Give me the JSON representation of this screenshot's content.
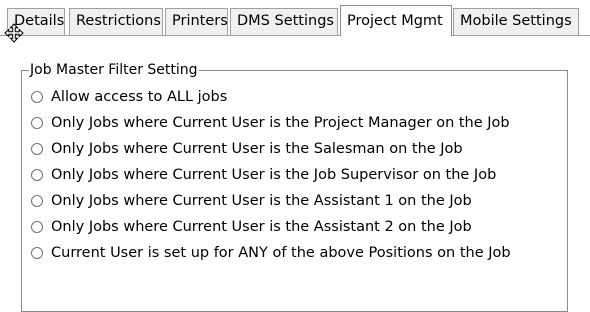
{
  "tabs": [
    {
      "label": "Details",
      "active": false
    },
    {
      "label": "Restrictions",
      "active": false
    },
    {
      "label": "Printers",
      "active": false
    },
    {
      "label": "DMS Settings",
      "active": false
    },
    {
      "label": "Project Mgmt",
      "active": true
    },
    {
      "label": "Mobile Settings",
      "active": false
    }
  ],
  "group": {
    "title": "Job Master Filter Setting",
    "options": [
      {
        "label": "Allow access to ALL jobs",
        "selected": false
      },
      {
        "label": "Only Jobs where Current User is the Project Manager on the Job",
        "selected": false
      },
      {
        "label": "Only Jobs where Current User is the Salesman on the Job",
        "selected": false
      },
      {
        "label": "Only Jobs where Current User is the Job Supervisor on the Job",
        "selected": false
      },
      {
        "label": "Only Jobs where Current User is the Assistant 1 on the Job",
        "selected": false
      },
      {
        "label": "Only Jobs where Current User is the Assistant 2 on the Job",
        "selected": false
      },
      {
        "label": "Current User is set up for ANY of the above Positions on the Job",
        "selected": false
      }
    ]
  },
  "icons": {
    "cursor": "move-cursor-icon",
    "radio": "radio-button-unchecked"
  }
}
